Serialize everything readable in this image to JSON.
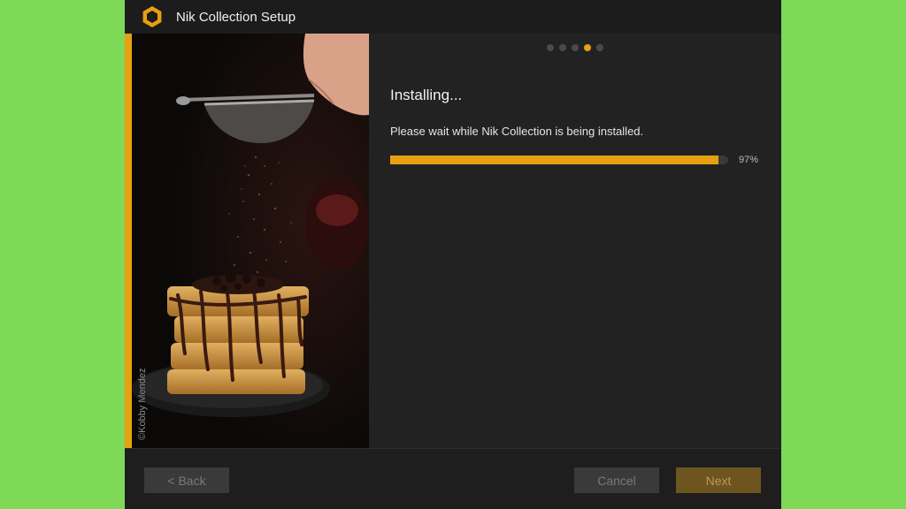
{
  "window": {
    "title": "Nik Collection Setup",
    "app_icon": "nik-hexagon-icon"
  },
  "side_panel": {
    "photo_credit": "©Kobby Mendez",
    "image": "waffles-with-cocoa-dusting-photo"
  },
  "steps": {
    "total": 5,
    "current": 4
  },
  "main": {
    "heading": "Installing...",
    "message": "Please wait while Nik Collection is being installed.",
    "progress_value": 97,
    "progress_label": "97%"
  },
  "footer": {
    "back_label": "< Back",
    "cancel_label": "Cancel",
    "next_label": "Next"
  },
  "colors": {
    "accent": "#e8a012",
    "background": "#222222",
    "titlebar": "#1c1c1c",
    "outer_background": "#7ed957"
  }
}
